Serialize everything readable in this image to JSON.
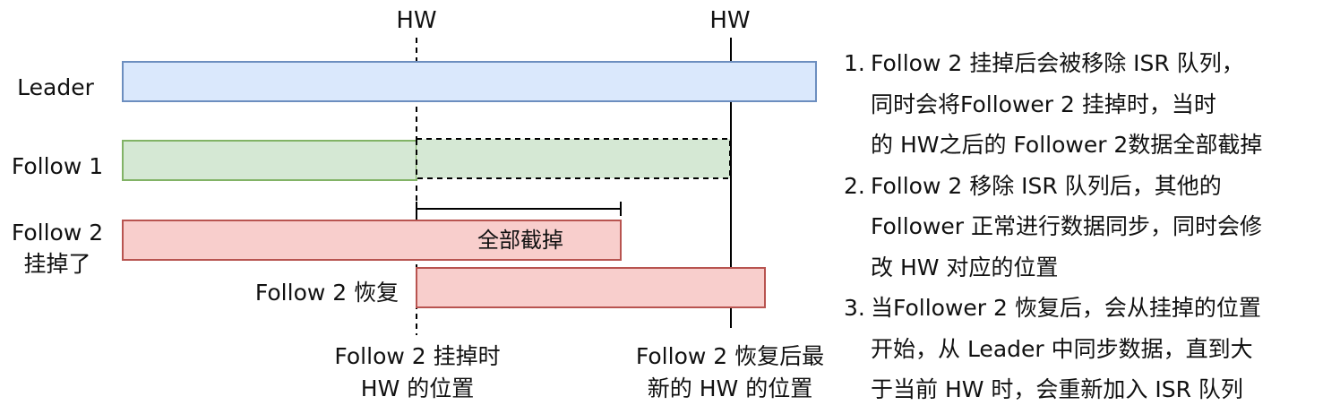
{
  "hw_labels": [
    "HW",
    "HW"
  ],
  "rows": {
    "leader": "Leader",
    "follow1": "Follow 1",
    "follow2_down": [
      "Follow 2",
      "挂掉了"
    ],
    "follow2_recover": "Follow 2 恢复"
  },
  "truncate_label": "全部截掉",
  "bottom_labels": {
    "left": [
      "Follow 2 挂掉时",
      "HW 的位置"
    ],
    "right": [
      "Follow 2 恢复后最",
      "新的 HW 的位置"
    ]
  },
  "notes": [
    {
      "num": "1.",
      "lines": [
        "Follow 2 挂掉后会被移除 ISR 队列，",
        "同时会将Follower 2 挂掉时，当时",
        "的 HW之后的 Follower 2数据全部截掉"
      ]
    },
    {
      "num": "2.",
      "lines": [
        "Follow 2 移除 ISR 队列后，其他的",
        "Follower 正常进行数据同步，同时会修",
        "改 HW 对应的位置"
      ]
    },
    {
      "num": "3.",
      "lines": [
        "当Follower 2 恢复后，会从挂掉的位置",
        "开始，从 Leader 中同步数据，直到大",
        "于当前 HW 时，会重新加入 ISR 队列"
      ]
    }
  ],
  "colors": {
    "leader_fill": "#dae8fc",
    "leader_stroke": "#6c8ebf",
    "follow1_fill": "#d5e8d4",
    "follow1_stroke": "#82b366",
    "follow2_fill": "#f8cecc",
    "follow2_stroke": "#b85450"
  }
}
